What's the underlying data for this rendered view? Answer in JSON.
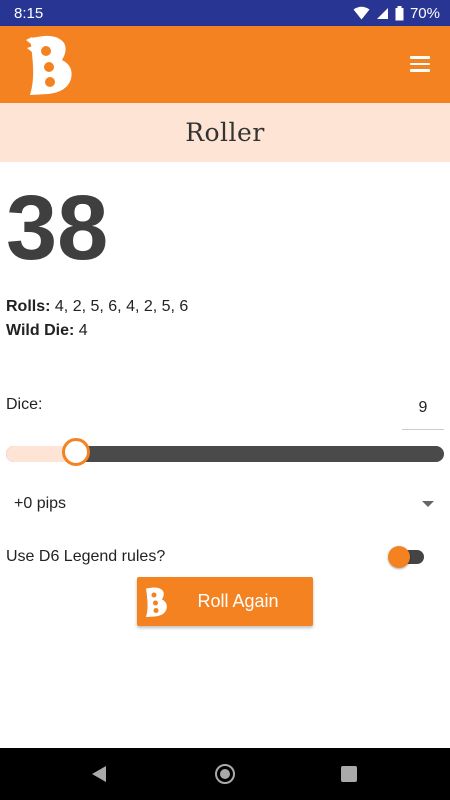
{
  "status_bar": {
    "time": "8:15",
    "battery": "70%",
    "icons": [
      "wifi-icon",
      "signal-icon",
      "battery-icon"
    ]
  },
  "app_bar": {
    "logo": "b-dice-logo-icon",
    "menu_icon": "hamburger-menu-icon"
  },
  "page": {
    "title": "Roller"
  },
  "result": {
    "total": "38",
    "rolls_label": "Rolls:",
    "rolls_value": "4, 2, 5, 6, 4, 2, 5, 6",
    "wild_label": "Wild Die:",
    "wild_value": "4"
  },
  "dice": {
    "label": "Dice:",
    "value": "9",
    "slider_fraction": 0.16
  },
  "pips": {
    "selected": "+0 pips"
  },
  "legend": {
    "label": "Use D6 Legend rules?",
    "enabled": true
  },
  "roll_button": {
    "label": "Roll Again"
  },
  "colors": {
    "accent": "#f58220",
    "status_bar": "#283593",
    "title_band": "#fde4d4",
    "slider_track": "#4a4a4a"
  }
}
